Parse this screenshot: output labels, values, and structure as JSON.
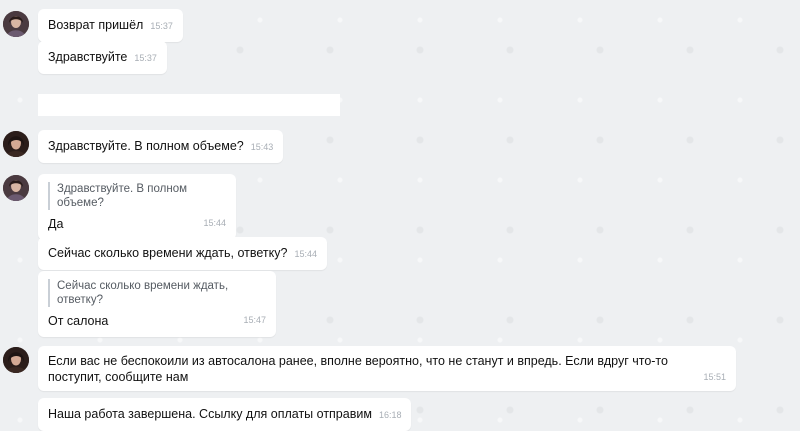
{
  "messages": [
    {
      "text": "Возврат пришёл",
      "time": "15:37"
    },
    {
      "text": "Здравствуйте",
      "time": "15:37"
    },
    {
      "text": "Здравствуйте. В полном объеме?",
      "time": "15:43"
    },
    {
      "quote": "Здравствуйте. В полном объеме?",
      "text": "Да",
      "time": "15:44"
    },
    {
      "text": "Сейчас сколько времени ждать, ответку?",
      "time": "15:44"
    },
    {
      "quote": "Сейчас сколько времени ждать, ответку?",
      "text": "От салона",
      "time": "15:47"
    },
    {
      "text": "Если вас не беспокоили из автосалона ранее, вполне вероятно, что не станут и впредь. Если вдруг что-то поступит, сообщите нам",
      "time": "15:51"
    },
    {
      "text": "Наша работа завершена. Ссылку для оплаты отправим",
      "time": "16:18"
    }
  ],
  "colors": {
    "background": "#eef0f2",
    "bubble": "#ffffff",
    "time": "#a8aeb5",
    "quote_border": "#c9cfd6"
  }
}
